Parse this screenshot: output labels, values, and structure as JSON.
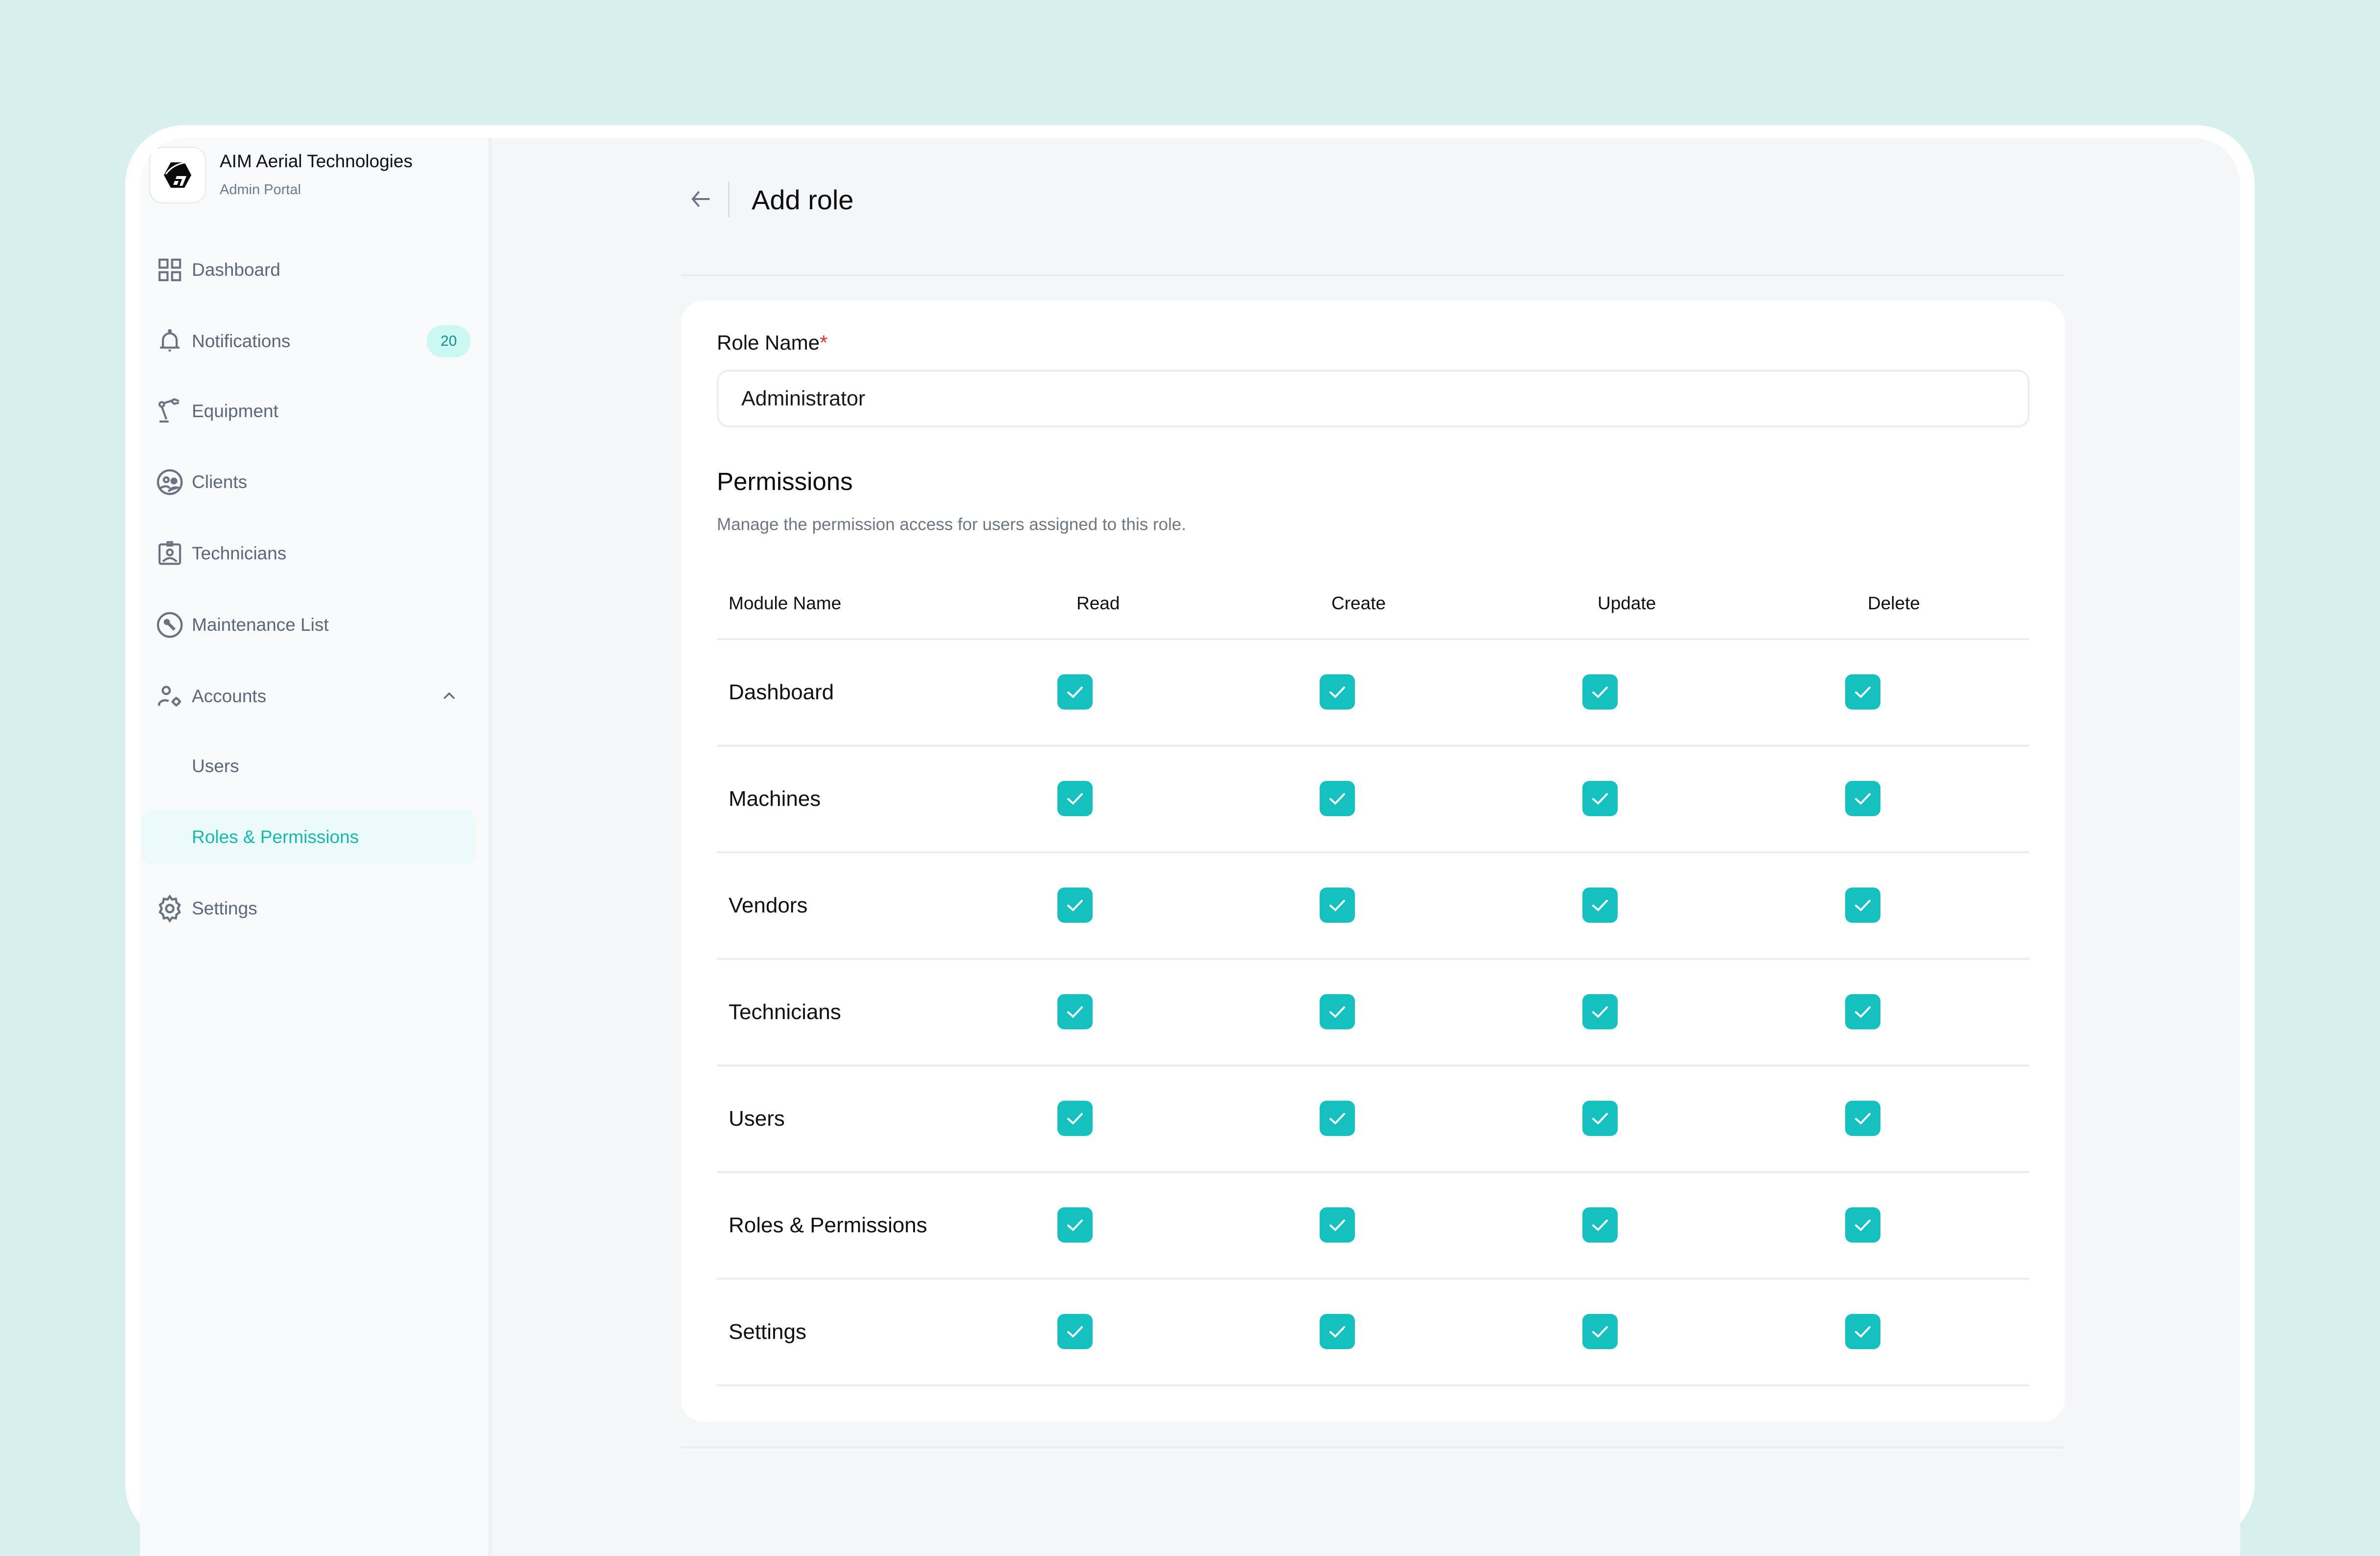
{
  "brand": {
    "name": "AIM Aerial Technologies",
    "subtitle": "Admin Portal"
  },
  "sidebar": {
    "items": [
      {
        "label": "Dashboard",
        "icon": "grid-icon"
      },
      {
        "label": "Notifications",
        "icon": "bell-icon",
        "badge": "20"
      },
      {
        "label": "Equipment",
        "icon": "robot-arm-icon"
      },
      {
        "label": "Clients",
        "icon": "clients-icon"
      },
      {
        "label": "Technicians",
        "icon": "id-badge-icon"
      },
      {
        "label": "Maintenance List",
        "icon": "wrench-circle-icon"
      },
      {
        "label": "Accounts",
        "icon": "user-gear-icon",
        "expanded": true
      },
      {
        "label": "Users",
        "sub": true
      },
      {
        "label": "Roles & Permissions",
        "sub": true,
        "active": true
      },
      {
        "label": "Settings",
        "icon": "gear-icon"
      }
    ]
  },
  "header": {
    "back_icon": "arrow-left-icon",
    "title": "Add role"
  },
  "form": {
    "role_name_label": "Role Name",
    "required_mark": "*",
    "role_name_value": "Administrator"
  },
  "permissions": {
    "title": "Permissions",
    "subtitle": "Manage the permission access for users assigned to this role.",
    "columns": [
      "Module Name",
      "Read",
      "Create",
      "Update",
      "Delete"
    ],
    "rows": [
      {
        "module": "Dashboard",
        "read": true,
        "create": true,
        "update": true,
        "delete": true
      },
      {
        "module": "Machines",
        "read": true,
        "create": true,
        "update": true,
        "delete": true
      },
      {
        "module": "Vendors",
        "read": true,
        "create": true,
        "update": true,
        "delete": true
      },
      {
        "module": "Technicians",
        "read": true,
        "create": true,
        "update": true,
        "delete": true
      },
      {
        "module": "Users",
        "read": true,
        "create": true,
        "update": true,
        "delete": true
      },
      {
        "module": "Roles & Permissions",
        "read": true,
        "create": true,
        "update": true,
        "delete": true
      },
      {
        "module": "Settings",
        "read": true,
        "create": true,
        "update": true,
        "delete": true
      }
    ]
  },
  "colors": {
    "accent": "#14c1be",
    "active_text": "#17b8ad",
    "background": "#d7f0ed",
    "required": "#e0303a"
  }
}
